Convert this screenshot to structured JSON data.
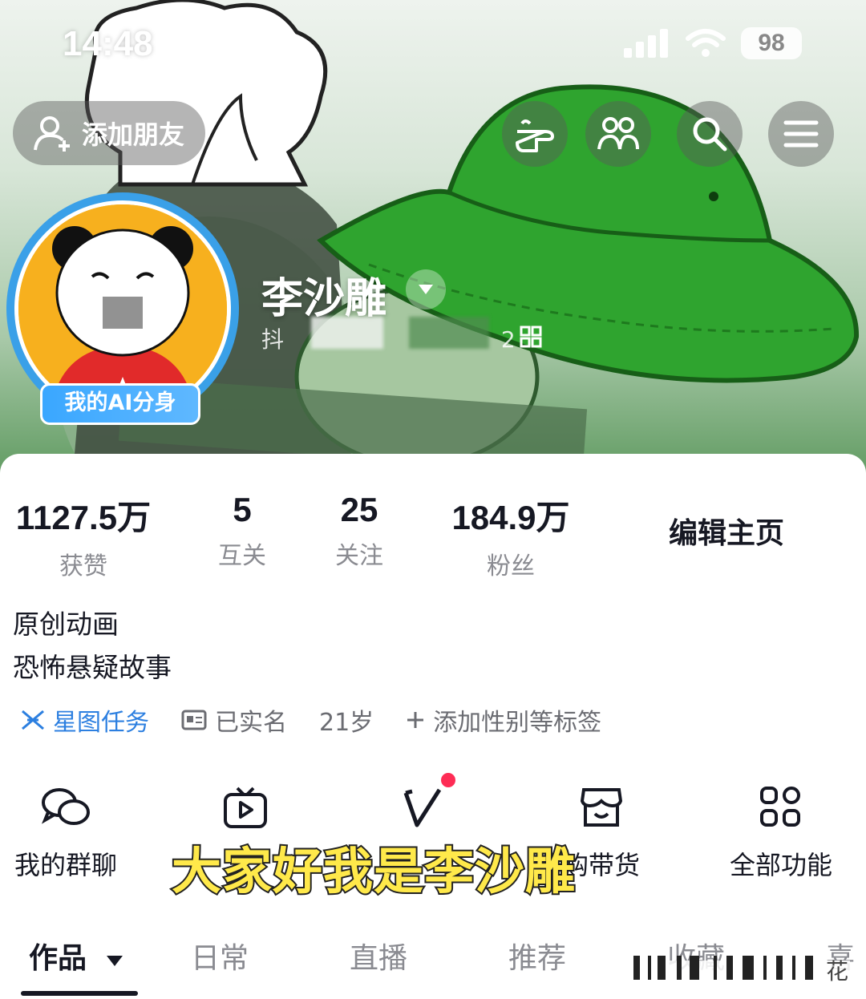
{
  "status_bar": {
    "time": "14:48",
    "battery": "98"
  },
  "header": {
    "add_friend_label": "添加朋友",
    "icons": [
      "pointing-hand-icon",
      "friends-icon",
      "search-icon",
      "menu-icon"
    ]
  },
  "profile": {
    "name": "李沙雕",
    "id_prefix": "抖",
    "id_suffix": "2",
    "ai_badge": "我的AI分身"
  },
  "stats": [
    {
      "value": "1127.5万",
      "label": "获赞"
    },
    {
      "value": "5",
      "label": "互关"
    },
    {
      "value": "25",
      "label": "关注"
    },
    {
      "value": "184.9万",
      "label": "粉丝"
    }
  ],
  "edit_label": "编辑主页",
  "bio": [
    "原创动画",
    "恐怖悬疑故事"
  ],
  "tags": {
    "xingtu": "星图任务",
    "verified": "已实名",
    "age": "21岁",
    "add_tags": "添加性别等标签"
  },
  "functions": [
    {
      "label": "我的群聊",
      "icon": "group-chat-icon"
    },
    {
      "label": "",
      "icon": "video-icon"
    },
    {
      "label": "",
      "icon": "v-icon"
    },
    {
      "label": "购带货",
      "icon": "shop-icon"
    },
    {
      "label": "全部功能",
      "icon": "grid-icon"
    }
  ],
  "subtitle": "大家好我是李沙雕",
  "tabs": [
    {
      "label": "作品",
      "active": true
    },
    {
      "label": "日常"
    },
    {
      "label": "直播"
    },
    {
      "label": "推荐"
    },
    {
      "label": "收藏"
    },
    {
      "label": "喜"
    }
  ],
  "watermark": "花"
}
